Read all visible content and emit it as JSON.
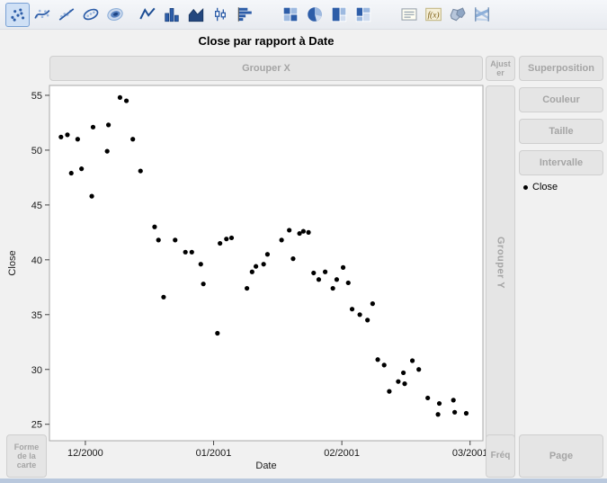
{
  "title": "Close par rapport à Date",
  "toolbar": {
    "items": [
      {
        "icon": "points-icon",
        "selected": true
      },
      {
        "icon": "smoother-icon",
        "selected": false
      },
      {
        "icon": "line-of-fit-icon",
        "selected": false
      },
      {
        "icon": "ellipse-icon",
        "selected": false
      },
      {
        "icon": "contour-icon",
        "selected": false
      },
      {
        "icon": "line-chart-icon",
        "selected": false
      },
      {
        "icon": "bar-chart-icon",
        "selected": false
      },
      {
        "icon": "area-chart-icon",
        "selected": false
      },
      {
        "icon": "box-plot-icon",
        "selected": false
      },
      {
        "icon": "histogram-icon",
        "selected": false
      },
      {
        "icon": "heatmap-icon",
        "selected": false
      },
      {
        "icon": "pie-chart-icon",
        "selected": false
      },
      {
        "icon": "treemap-icon",
        "selected": false
      },
      {
        "icon": "mosaic-icon",
        "selected": false
      },
      {
        "icon": "caption-box-icon",
        "selected": false
      },
      {
        "icon": "formula-icon",
        "selected": false
      },
      {
        "icon": "map-shapes-icon",
        "selected": false
      },
      {
        "icon": "parallel-plot-icon",
        "selected": false
      }
    ]
  },
  "drop_zones": {
    "group_x": "Grouper X",
    "ajuster": "Ajuster",
    "superposition": "Superposition",
    "couleur": "Couleur",
    "taille": "Taille",
    "intervalle": "Intervalle",
    "group_y": "Grouper Y",
    "map_shape": "Forme de la carte",
    "freq": "Fréq",
    "page": "Page"
  },
  "legend": {
    "items": [
      {
        "label": "Close",
        "marker_color": "#000000"
      }
    ]
  },
  "chart_data": {
    "type": "scatter",
    "title": "Close par rapport à Date",
    "xlabel": "Date",
    "ylabel": "Close",
    "x_unit": "months since 2000-12",
    "x_ticks": [
      {
        "value": 0,
        "label": "12/2000"
      },
      {
        "value": 1,
        "label": "01/2001"
      },
      {
        "value": 2,
        "label": "02/2001"
      },
      {
        "value": 3,
        "label": "03/2001"
      }
    ],
    "y_ticks": [
      25,
      30,
      35,
      40,
      45,
      50,
      55
    ],
    "xlim": [
      -0.28,
      3.1
    ],
    "ylim": [
      23.5,
      55.9
    ],
    "grid": false,
    "legend_position": "right",
    "marker_color": "#000000",
    "series": [
      {
        "name": "Close",
        "points": [
          [
            -0.19,
            51.2
          ],
          [
            -0.14,
            51.4
          ],
          [
            -0.11,
            47.9
          ],
          [
            -0.06,
            51.0
          ],
          [
            -0.03,
            48.3
          ],
          [
            0.05,
            45.8
          ],
          [
            0.06,
            52.1
          ],
          [
            0.17,
            49.9
          ],
          [
            0.18,
            52.3
          ],
          [
            0.27,
            54.8
          ],
          [
            0.32,
            54.5
          ],
          [
            0.37,
            51.0
          ],
          [
            0.43,
            48.1
          ],
          [
            0.54,
            43.0
          ],
          [
            0.57,
            41.8
          ],
          [
            0.61,
            36.6
          ],
          [
            0.7,
            41.8
          ],
          [
            0.78,
            40.7
          ],
          [
            0.83,
            40.7
          ],
          [
            0.9,
            39.6
          ],
          [
            0.92,
            37.8
          ],
          [
            1.03,
            33.3
          ],
          [
            1.05,
            41.5
          ],
          [
            1.1,
            41.9
          ],
          [
            1.14,
            42.0
          ],
          [
            1.26,
            37.4
          ],
          [
            1.3,
            38.9
          ],
          [
            1.33,
            39.4
          ],
          [
            1.39,
            39.6
          ],
          [
            1.42,
            40.5
          ],
          [
            1.53,
            41.8
          ],
          [
            1.59,
            42.7
          ],
          [
            1.62,
            40.1
          ],
          [
            1.67,
            42.4
          ],
          [
            1.7,
            42.6
          ],
          [
            1.74,
            42.5
          ],
          [
            1.78,
            38.8
          ],
          [
            1.82,
            38.2
          ],
          [
            1.87,
            38.9
          ],
          [
            1.93,
            37.4
          ],
          [
            1.96,
            38.2
          ],
          [
            2.01,
            39.3
          ],
          [
            2.05,
            37.9
          ],
          [
            2.08,
            35.5
          ],
          [
            2.14,
            35.0
          ],
          [
            2.2,
            34.5
          ],
          [
            2.24,
            36.0
          ],
          [
            2.28,
            30.9
          ],
          [
            2.33,
            30.4
          ],
          [
            2.37,
            28.0
          ],
          [
            2.44,
            28.9
          ],
          [
            2.48,
            29.7
          ],
          [
            2.49,
            28.7
          ],
          [
            2.55,
            30.8
          ],
          [
            2.6,
            30.0
          ],
          [
            2.67,
            27.4
          ],
          [
            2.75,
            25.9
          ],
          [
            2.76,
            26.9
          ],
          [
            2.87,
            27.2
          ],
          [
            2.88,
            26.1
          ],
          [
            2.97,
            26.0
          ]
        ]
      }
    ]
  }
}
